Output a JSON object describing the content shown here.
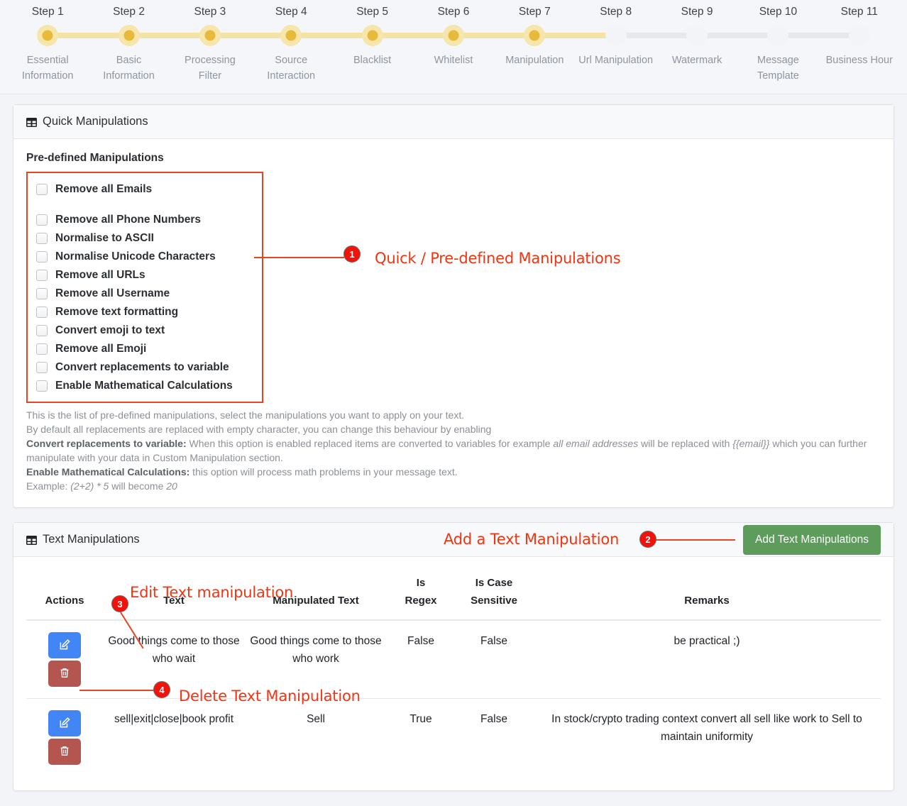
{
  "stepper": {
    "steps": [
      {
        "number": "Step 1",
        "label": "Essential Information",
        "active": true
      },
      {
        "number": "Step 2",
        "label": "Basic Information",
        "active": true
      },
      {
        "number": "Step 3",
        "label": "Processing Filter",
        "active": true
      },
      {
        "number": "Step 4",
        "label": "Source Interaction",
        "active": true
      },
      {
        "number": "Step 5",
        "label": "Blacklist",
        "active": true
      },
      {
        "number": "Step 6",
        "label": "Whitelist",
        "active": true
      },
      {
        "number": "Step 7",
        "label": "Manipulation",
        "active": true
      },
      {
        "number": "Step 8",
        "label": "Url Manipulation",
        "active": false
      },
      {
        "number": "Step 9",
        "label": "Watermark",
        "active": false
      },
      {
        "number": "Step 10",
        "label": "Message Template",
        "active": false
      },
      {
        "number": "Step 11",
        "label": "Business Hour",
        "active": false
      }
    ]
  },
  "quick_card": {
    "title": "Quick Manipulations",
    "section_heading": "Pre-defined Manipulations",
    "checkboxes": [
      {
        "label": "Remove all Emails",
        "checked": false,
        "spaced": true
      },
      {
        "label": "Remove all Phone Numbers",
        "checked": false,
        "spaced": false
      },
      {
        "label": "Normalise to ASCII",
        "checked": false,
        "spaced": false
      },
      {
        "label": "Normalise Unicode Characters",
        "checked": false,
        "spaced": false
      },
      {
        "label": "Remove all URLs",
        "checked": false,
        "spaced": false
      },
      {
        "label": "Remove all Username",
        "checked": false,
        "spaced": false
      },
      {
        "label": "Remove text formatting",
        "checked": false,
        "spaced": false
      },
      {
        "label": "Convert emoji to text",
        "checked": false,
        "spaced": false
      },
      {
        "label": "Remove all Emoji",
        "checked": false,
        "spaced": false
      },
      {
        "label": "Convert replacements to variable",
        "checked": false,
        "spaced": false
      },
      {
        "label": "Enable Mathematical Calculations",
        "checked": false,
        "spaced": false
      }
    ],
    "help": {
      "line1": "This is the list of pre-defined manipulations, select the manipulations you want to apply on your text.",
      "line2": "By default all replacements are replaced with empty character, you can change this behaviour by enabling",
      "line3_bold": "Convert replacements to variable:",
      "line3_a": " When this option is enabled replaced items are converted to variables for example ",
      "line3_italic1": "all email addresses",
      "line3_b": " will be replaced with ",
      "line3_italic2": "{{email}}",
      "line3_c": " which you can further manipulate with your data in Custom Manipulation section.",
      "line4_bold": "Enable Mathematical Calculations:",
      "line4_a": " this option will process math problems in your message text.",
      "line5_a": "Example: ",
      "line5_italic1": "(2+2) * 5",
      "line5_b": " will become ",
      "line5_italic2": "20"
    }
  },
  "text_card": {
    "title": "Text Manipulations",
    "add_button": "Add Text Manipulations",
    "columns": {
      "actions": "Actions",
      "text": "Text",
      "manipulated_text": "Manipulated Text",
      "is_regex_l1": "Is",
      "is_regex_l2": "Regex",
      "is_case_l1": "Is Case",
      "is_case_l2": "Sensitive",
      "remarks": "Remarks"
    },
    "rows": [
      {
        "text": "Good things come to those who wait",
        "manipulated_text": "Good things come to those who work",
        "is_regex": "False",
        "is_case_sensitive": "False",
        "remarks": "be practical ;)"
      },
      {
        "text": "sell|exit|close|book profit",
        "manipulated_text": "Sell",
        "is_regex": "True",
        "is_case_sensitive": "False",
        "remarks": "In stock/crypto trading context convert all sell like work to Sell to maintain uniformity"
      }
    ]
  },
  "annotations": [
    {
      "number": "1",
      "text": "Quick / Pre-defined Manipulations"
    },
    {
      "number": "2",
      "text": "Add a Text Manipulation"
    },
    {
      "number": "3",
      "text": "Edit Text manipulation"
    },
    {
      "number": "4",
      "text": "Delete Text Manipulation"
    }
  ],
  "colors": {
    "annotation_red": "#f4330f",
    "badge_red": "#f4110a",
    "step_active": "#e7ba3c",
    "step_active_ring": "#f6e6ab",
    "add_button_green": "#5d9c5b",
    "edit_button_blue": "#4285f4",
    "delete_button_red": "#b5554f"
  }
}
